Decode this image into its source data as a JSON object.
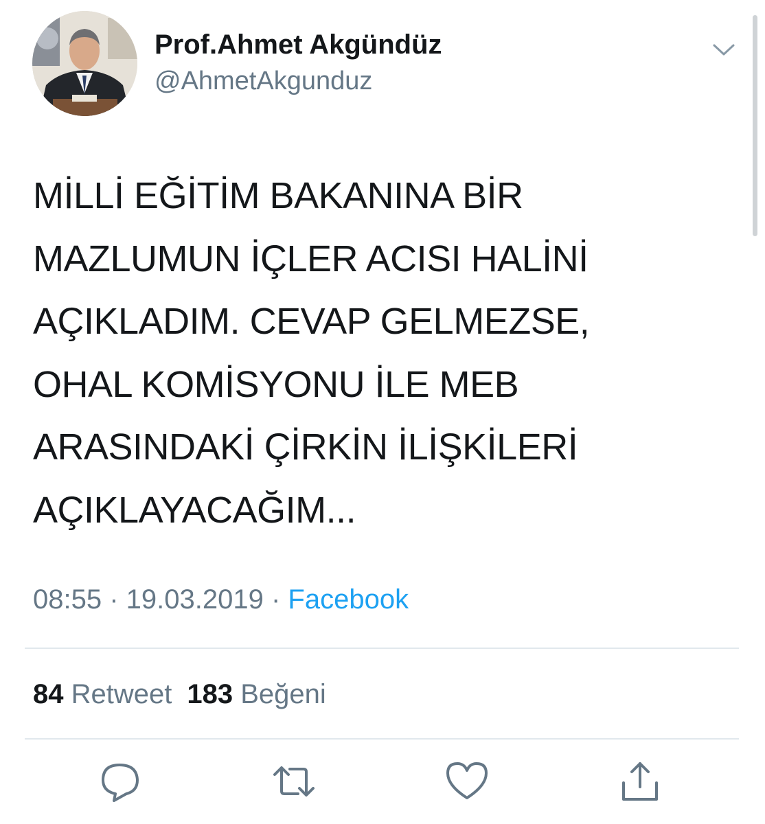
{
  "user": {
    "display_name": "Prof.Ahmet Akgündüz",
    "handle": "@AhmetAkgunduz"
  },
  "tweet": {
    "text": "MİLLİ EĞİTİM BAKANINA BİR\nMAZLUMUN İÇLER ACISI HALİNİ\nAÇIKLADIM. CEVAP GELMEZSE,\nOHAL KOMİSYONU İLE MEB\nARASINDAKİ ÇİRKİN İLİŞKİLERİ\nAÇIKLAYACAĞIM...",
    "time": "08:55",
    "separator": " · ",
    "date": "19.03.2019",
    "source": "Facebook"
  },
  "stats": {
    "retweet_count": "84",
    "retweet_label": "Retweet",
    "like_count": "183",
    "like_label": "Beğeni"
  },
  "icons": {
    "caret": "chevron-down-icon",
    "reply": "reply-icon",
    "retweet": "retweet-icon",
    "like": "heart-icon",
    "share": "share-icon"
  },
  "colors": {
    "text": "#14171a",
    "secondary": "#657786",
    "link": "#1da1f2",
    "divider": "#e1e8ed"
  }
}
